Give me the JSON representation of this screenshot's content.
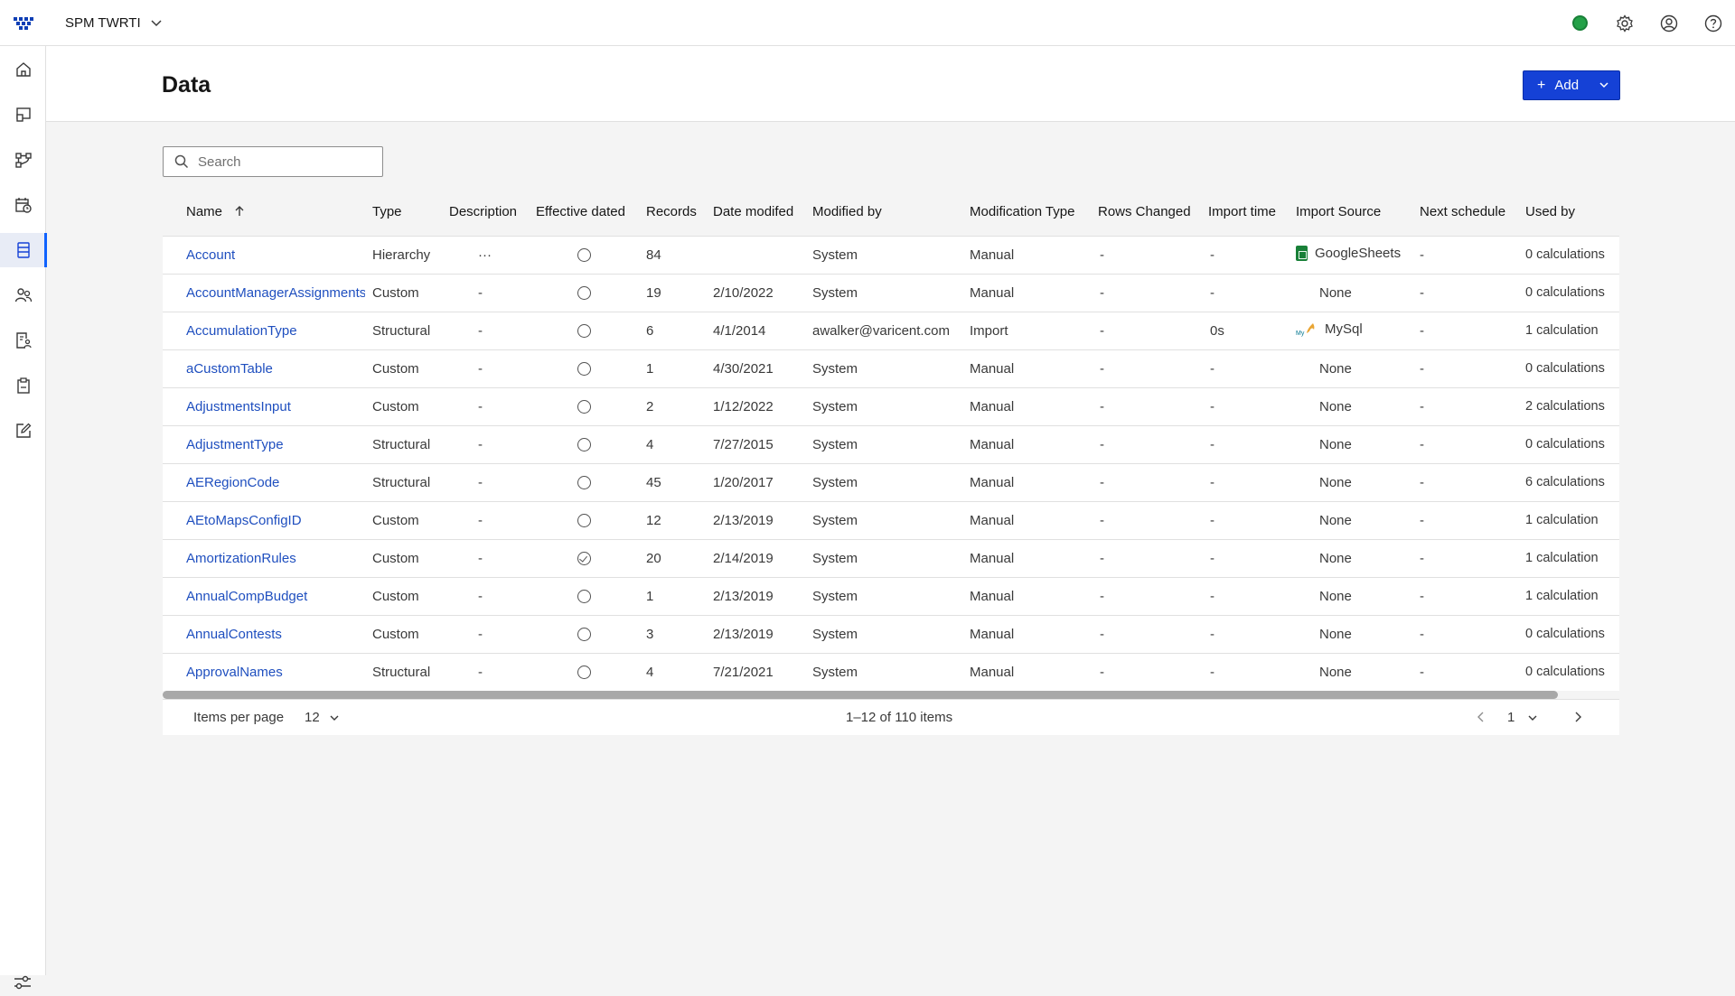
{
  "app": {
    "workspace_name": "SPM TWRTI"
  },
  "header": {
    "title": "Data",
    "add_label": "Add"
  },
  "search": {
    "placeholder": "Search"
  },
  "table": {
    "columns": [
      "Name",
      "Type",
      "Description",
      "Effective dated",
      "Records",
      "Date modifed",
      "Modified by",
      "Modification Type",
      "Rows Changed",
      "Import time",
      "Import Source",
      "Next schedule",
      "Used by"
    ],
    "rows": [
      {
        "name": "Account",
        "type": "Hierarchy",
        "description": "···",
        "effective_dated": false,
        "records": "84",
        "date_modified": "",
        "modified_by": "System",
        "modification_type": "Manual",
        "rows_changed": "-",
        "import_time": "-",
        "import_source": "GoogleSheets",
        "source_icon": "google-sheets-icon",
        "next_schedule": "-",
        "used_by": "0 calculations"
      },
      {
        "name": "AccountManagerAssignments",
        "type": "Custom",
        "description": "-",
        "effective_dated": false,
        "records": "19",
        "date_modified": "2/10/2022",
        "modified_by": "System",
        "modification_type": "Manual",
        "rows_changed": "-",
        "import_time": "-",
        "import_source": "None",
        "source_icon": "",
        "next_schedule": "-",
        "used_by": "0 calculations"
      },
      {
        "name": "AccumulationType",
        "type": "Structural",
        "description": "-",
        "effective_dated": false,
        "records": "6",
        "date_modified": "4/1/2014",
        "modified_by": "awalker@varicent.com",
        "modification_type": "Import",
        "rows_changed": "-",
        "import_time": "0s",
        "import_source": "MySql",
        "source_icon": "mysql-icon",
        "next_schedule": "-",
        "used_by": "1 calculation"
      },
      {
        "name": "aCustomTable",
        "type": "Custom",
        "description": "-",
        "effective_dated": false,
        "records": "1",
        "date_modified": "4/30/2021",
        "modified_by": "System",
        "modification_type": "Manual",
        "rows_changed": "-",
        "import_time": "-",
        "import_source": "None",
        "source_icon": "",
        "next_schedule": "-",
        "used_by": "0 calculations"
      },
      {
        "name": "AdjustmentsInput",
        "type": "Custom",
        "description": "-",
        "effective_dated": false,
        "records": "2",
        "date_modified": "1/12/2022",
        "modified_by": "System",
        "modification_type": "Manual",
        "rows_changed": "-",
        "import_time": "-",
        "import_source": "None",
        "source_icon": "",
        "next_schedule": "-",
        "used_by": "2 calculations"
      },
      {
        "name": "AdjustmentType",
        "type": "Structural",
        "description": "-",
        "effective_dated": false,
        "records": "4",
        "date_modified": "7/27/2015",
        "modified_by": "System",
        "modification_type": "Manual",
        "rows_changed": "-",
        "import_time": "-",
        "import_source": "None",
        "source_icon": "",
        "next_schedule": "-",
        "used_by": "0 calculations"
      },
      {
        "name": "AERegionCode",
        "type": "Structural",
        "description": "-",
        "effective_dated": false,
        "records": "45",
        "date_modified": "1/20/2017",
        "modified_by": "System",
        "modification_type": "Manual",
        "rows_changed": "-",
        "import_time": "-",
        "import_source": "None",
        "source_icon": "",
        "next_schedule": "-",
        "used_by": "6 calculations"
      },
      {
        "name": "AEtoMapsConfigID",
        "type": "Custom",
        "description": "-",
        "effective_dated": false,
        "records": "12",
        "date_modified": "2/13/2019",
        "modified_by": "System",
        "modification_type": "Manual",
        "rows_changed": "-",
        "import_time": "-",
        "import_source": "None",
        "source_icon": "",
        "next_schedule": "-",
        "used_by": "1 calculation"
      },
      {
        "name": "AmortizationRules",
        "type": "Custom",
        "description": "-",
        "effective_dated": true,
        "records": "20",
        "date_modified": "2/14/2019",
        "modified_by": "System",
        "modification_type": "Manual",
        "rows_changed": "-",
        "import_time": "-",
        "import_source": "None",
        "source_icon": "",
        "next_schedule": "-",
        "used_by": "1 calculation"
      },
      {
        "name": "AnnualCompBudget",
        "type": "Custom",
        "description": "-",
        "effective_dated": false,
        "records": "1",
        "date_modified": "2/13/2019",
        "modified_by": "System",
        "modification_type": "Manual",
        "rows_changed": "-",
        "import_time": "-",
        "import_source": "None",
        "source_icon": "",
        "next_schedule": "-",
        "used_by": "1 calculation"
      },
      {
        "name": "AnnualContests",
        "type": "Custom",
        "description": "-",
        "effective_dated": false,
        "records": "3",
        "date_modified": "2/13/2019",
        "modified_by": "System",
        "modification_type": "Manual",
        "rows_changed": "-",
        "import_time": "-",
        "import_source": "None",
        "source_icon": "",
        "next_schedule": "-",
        "used_by": "0 calculations"
      },
      {
        "name": "ApprovalNames",
        "type": "Structural",
        "description": "-",
        "effective_dated": false,
        "records": "4",
        "date_modified": "7/21/2021",
        "modified_by": "System",
        "modification_type": "Manual",
        "rows_changed": "-",
        "import_time": "-",
        "import_source": "None",
        "source_icon": "",
        "next_schedule": "-",
        "used_by": "0 calculations"
      }
    ]
  },
  "pagination": {
    "items_per_page_label": "Items per page",
    "items_per_page": "12",
    "range_text": "1–12 of 110 items",
    "current_page": "1"
  },
  "colors": {
    "primary": "#1541d6",
    "link": "#1f4fbf",
    "status": "#24a148"
  },
  "icons": {
    "sidebar": [
      "home-icon",
      "dashboard-icon",
      "workflow-icon",
      "schedule-icon",
      "data-icon",
      "people-icon",
      "user-report-icon",
      "clipboard-icon",
      "edit-icon"
    ],
    "sidebar_bottom": "settings-sliders-icon",
    "topbar": [
      "status-icon",
      "gear-icon",
      "user-avatar-icon",
      "help-icon"
    ]
  }
}
